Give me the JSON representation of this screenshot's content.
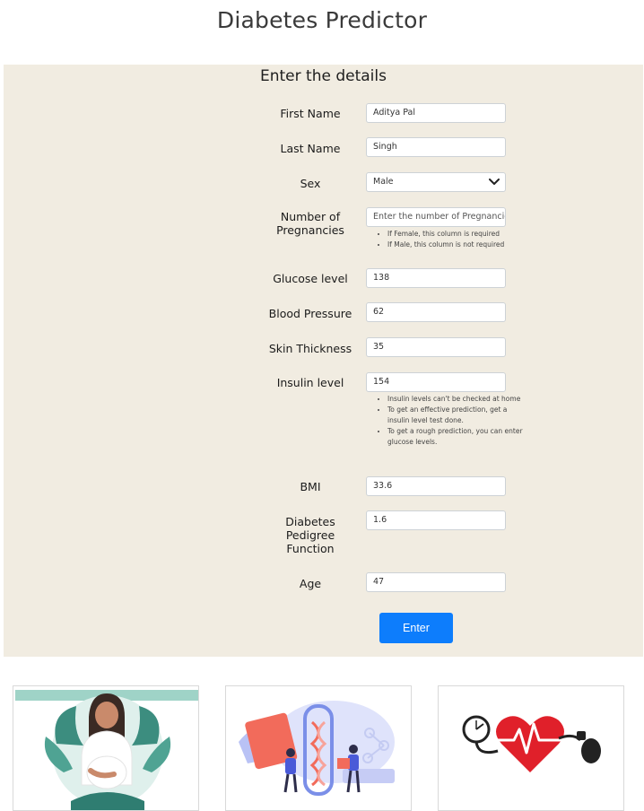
{
  "header": {
    "title": "Diabetes Predictor"
  },
  "form": {
    "heading": "Enter the details",
    "first_name": {
      "label": "First Name",
      "value": "Aditya Pal"
    },
    "last_name": {
      "label": "Last Name",
      "value": "Singh"
    },
    "sex": {
      "label": "Sex",
      "selected": "Male"
    },
    "pregnancies": {
      "label_line1": "Number of",
      "label_line2": "Pregnancies",
      "placeholder": "Enter the number of Pregnancies",
      "hints": [
        "If Female, this column is required",
        "If Male, this column is not required"
      ]
    },
    "glucose": {
      "label": "Glucose level",
      "value": "138"
    },
    "blood_pressure": {
      "label": "Blood Pressure",
      "value": "62"
    },
    "skin_thickness": {
      "label": "Skin Thickness",
      "value": "35"
    },
    "insulin": {
      "label": "Insulin level",
      "value": "154",
      "hints": [
        "Insulin levels can't be checked at home",
        "To get an effective prediction, get a insulin level test done.",
        "To get a rough prediction, you can enter glucose levels."
      ]
    },
    "bmi": {
      "label": "BMI",
      "value": "33.6"
    },
    "pedigree": {
      "label_line1": "Diabetes",
      "label_line2": "Pedigree",
      "label_line3": "Function",
      "value": "1.6"
    },
    "age": {
      "label": "Age",
      "value": "47"
    },
    "submit_label": "Enter"
  },
  "colors": {
    "panel_bg": "#f1ece1",
    "button_bg": "#0d7dfc",
    "heart_red": "#e0202a"
  },
  "cards": [
    {
      "image": "pregnant-woman-illustration"
    },
    {
      "image": "lab-research-illustration"
    },
    {
      "image": "blood-pressure-heart-illustration"
    }
  ]
}
